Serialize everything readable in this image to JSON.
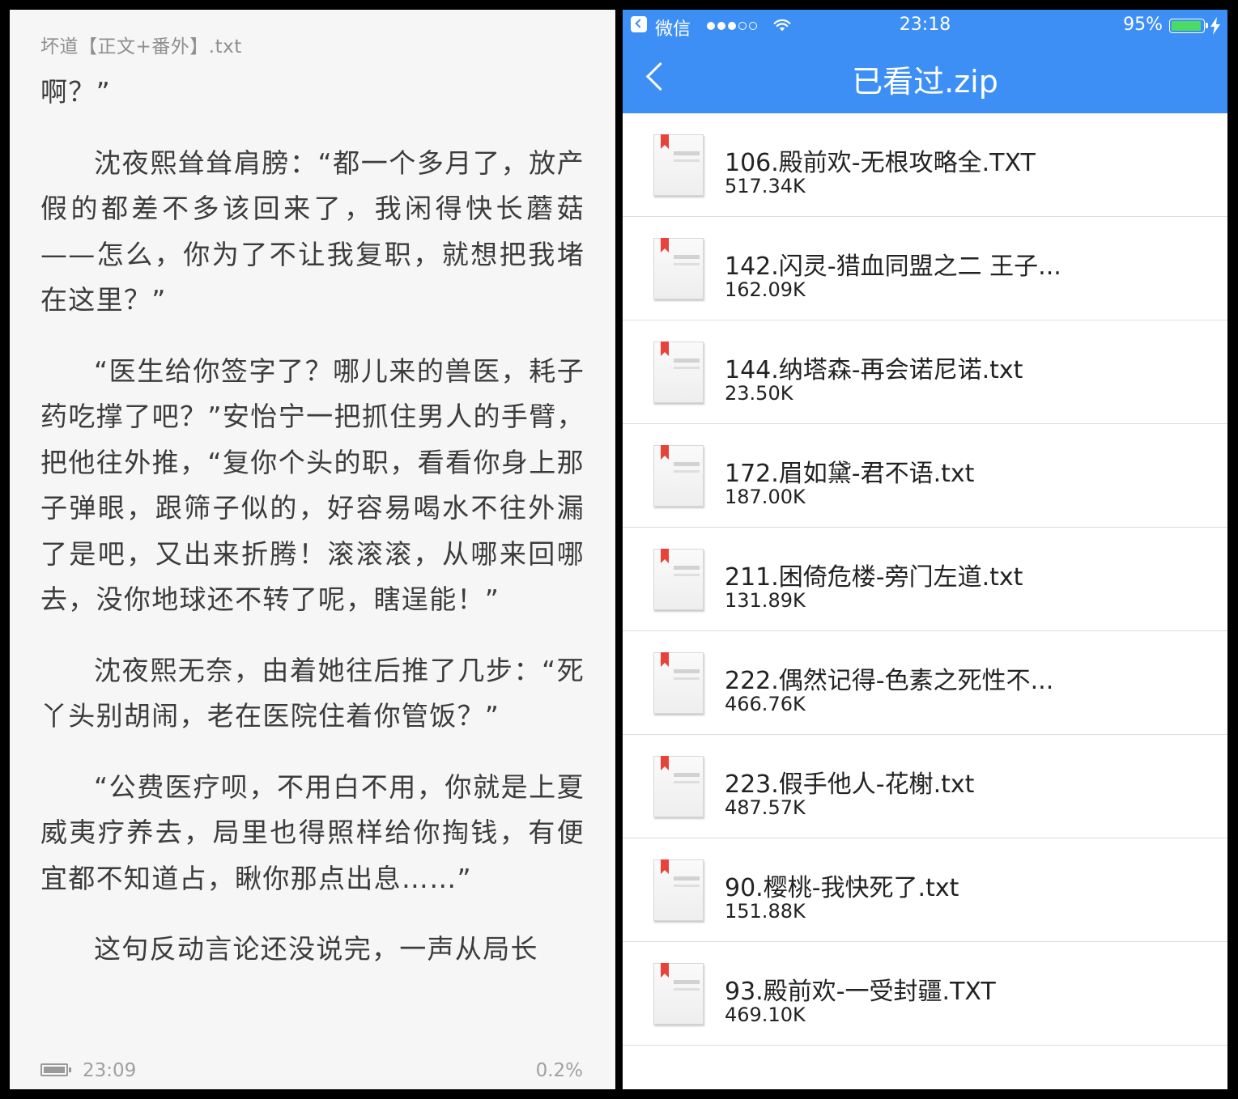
{
  "reader": {
    "title": "坏道【正文+番外】.txt",
    "paragraphs": [
      "啊？”",
      "沈夜熙耸耸肩膀：“都一个多月了，放产假的都差不多该回来了，我闲得快长蘑菇——怎么，你为了不让我复职，就想把我堵在这里？”",
      "“医生给你签字了？哪儿来的兽医，耗子药吃撑了吧？”安怡宁一把抓住男人的手臂，把他往外推，“复你个头的职，看看你身上那子弹眼，跟筛子似的，好容易喝水不往外漏了是吧，又出来折腾！滚滚滚，从哪来回哪去，没你地球还不转了呢，瞎逞能！”",
      "沈夜熙无奈，由着她往后推了几步：“死丫头别胡闹，老在医院住着你管饭？”",
      "“公费医疗呗，不用白不用，你就是上夏威夷疗养去，局里也得照样给你掏钱，有便宜都不知道占，瞅你那点出息……”",
      "这句反动言论还没说完，一声从局长"
    ],
    "time": "23:09",
    "progress": "0.2%"
  },
  "phone": {
    "status": {
      "carrier": "微信",
      "time": "23:18",
      "battery_pct": "95%",
      "battery_level": 0.95,
      "battery_color": "#4cd964"
    },
    "nav": {
      "title": "已看过.zip",
      "back_icon": "chevron-left-icon"
    },
    "accent": "#3d8ff6",
    "files": [
      {
        "name": "106.殿前欢-无根攻略全.TXT",
        "size": "517.34K"
      },
      {
        "name": "142.闪灵-猎血同盟之二 王子...",
        "size": "162.09K"
      },
      {
        "name": "144.纳塔森-再会诺尼诺.txt",
        "size": "23.50K"
      },
      {
        "name": "172.眉如黛-君不语.txt",
        "size": "187.00K"
      },
      {
        "name": "211.困倚危楼-旁门左道.txt",
        "size": "131.89K"
      },
      {
        "name": "222.偶然记得-色素之死性不...",
        "size": "466.76K"
      },
      {
        "name": "223.假手他人-花榭.txt",
        "size": "487.57K"
      },
      {
        "name": "90.樱桃-我快死了.txt",
        "size": "151.88K"
      },
      {
        "name": "93.殿前欢-一受封疆.TXT",
        "size": "469.10K"
      }
    ]
  }
}
